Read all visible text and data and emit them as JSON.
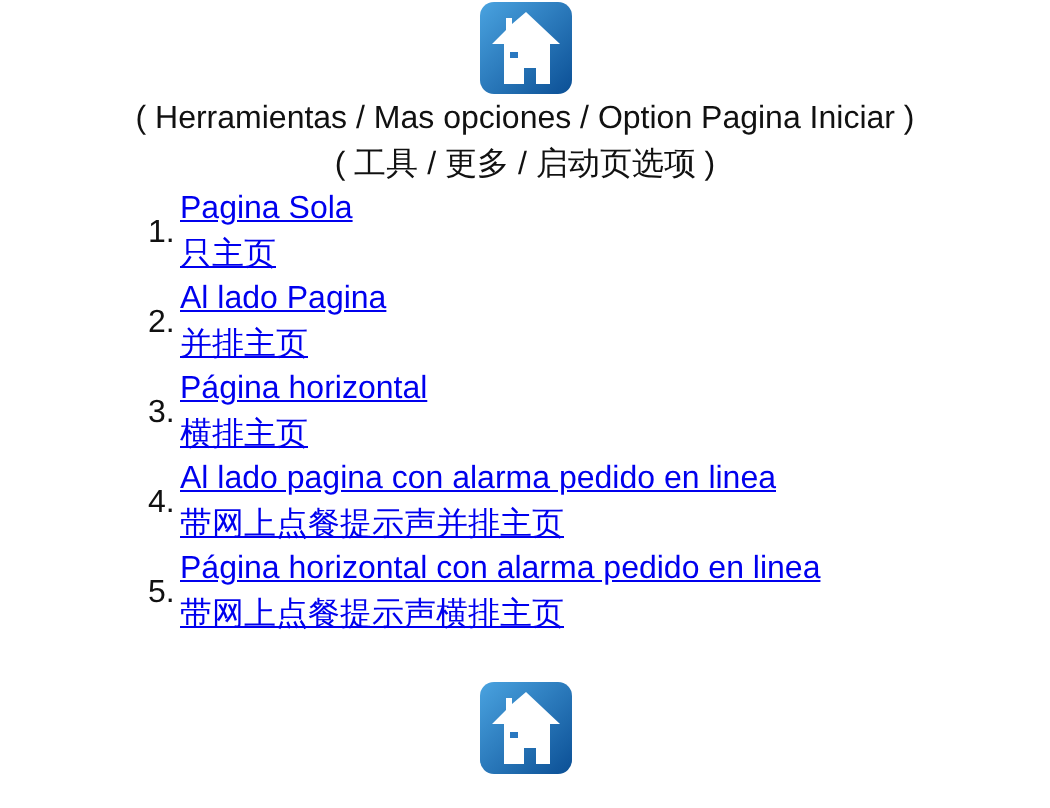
{
  "path_es": "( Herramientas / Mas opciones / Option Pagina Iniciar )",
  "path_zh": "( 工具 / 更多 / 启动页选项 )",
  "options": [
    {
      "number": "1.",
      "label_es": "Pagina Sola",
      "label_zh": "只主页"
    },
    {
      "number": "2.",
      "label_es": "Al lado Pagina",
      "label_zh": "并排主页"
    },
    {
      "number": "3.",
      "label_es": "Página horizontal",
      "label_zh": "横排主页"
    },
    {
      "number": "4.",
      "label_es": "Al lado pagina con alarma pedido en linea",
      "label_zh": "带网上点餐提示声并排主页"
    },
    {
      "number": "5.",
      "label_es": "Página horizontal con alarma pedido en linea",
      "label_zh": "带网上点餐提示声横排主页"
    }
  ]
}
